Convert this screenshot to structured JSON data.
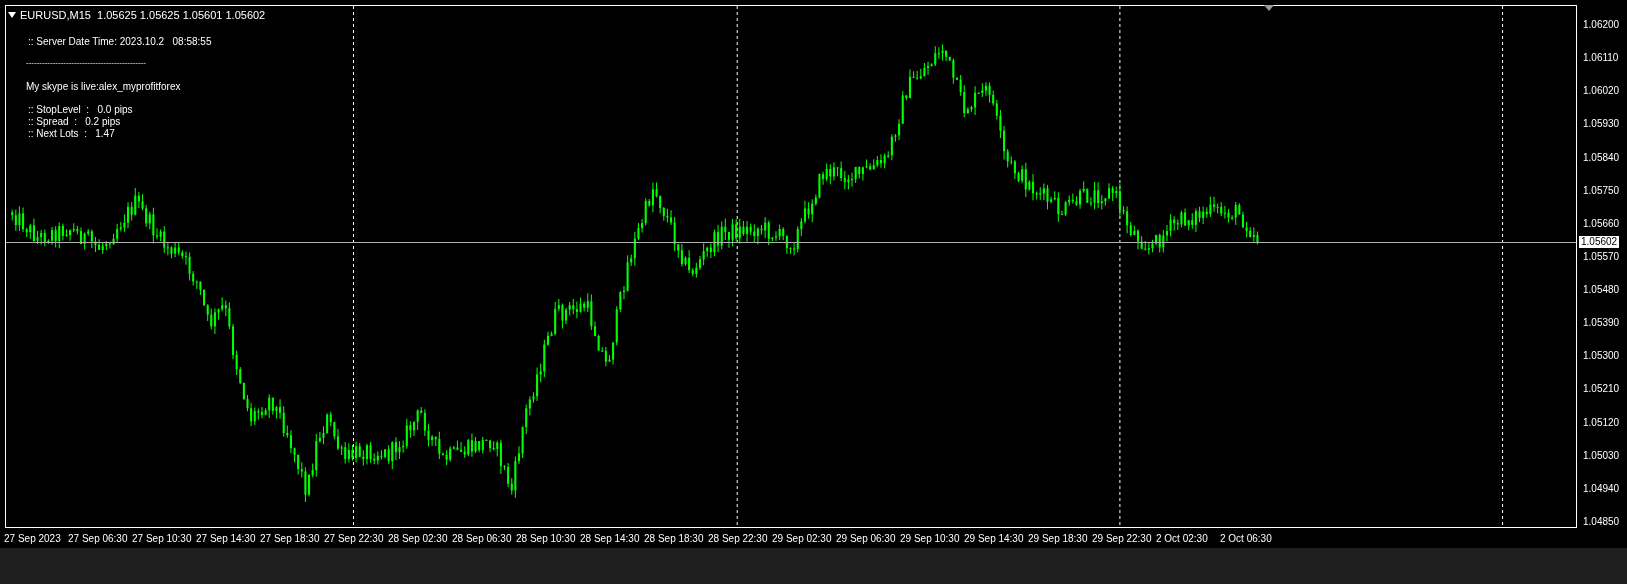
{
  "chart_header": {
    "symbol_line": "EURUSD,M15  1.05625 1.05625 1.05601 1.05602"
  },
  "info_panel": {
    "server_time": ":: Server Date Time: 2023.10.2   08:58:55",
    "separator": "---------------------------------------------",
    "contact": "My skype is live:alex_myprofitforex",
    "stats": [
      ":: StopLevel  :   0.0 pips",
      ":: Spread  :   0.2 pips",
      ":: Next Lots  :   1.47"
    ]
  },
  "price_axis": [
    "1.06200",
    "1.06110",
    "1.06020",
    "1.05930",
    "1.05840",
    "1.05750",
    "1.05660",
    "1.05570",
    "1.05480",
    "1.05390",
    "1.05300",
    "1.05210",
    "1.05120",
    "1.05030",
    "1.04940",
    "1.04850"
  ],
  "current_price": "1.05602",
  "time_axis": [
    "27 Sep 2023",
    "27 Sep 06:30",
    "27 Sep 10:30",
    "27 Sep 14:30",
    "27 Sep 18:30",
    "27 Sep 22:30",
    "28 Sep 02:30",
    "28 Sep 06:30",
    "28 Sep 10:30",
    "28 Sep 14:30",
    "28 Sep 18:30",
    "28 Sep 22:30",
    "29 Sep 02:30",
    "29 Sep 06:30",
    "29 Sep 10:30",
    "29 Sep 14:30",
    "29 Sep 18:30",
    "29 Sep 22:30",
    "2 Oct 02:30",
    "2 Oct 06:30"
  ]
}
